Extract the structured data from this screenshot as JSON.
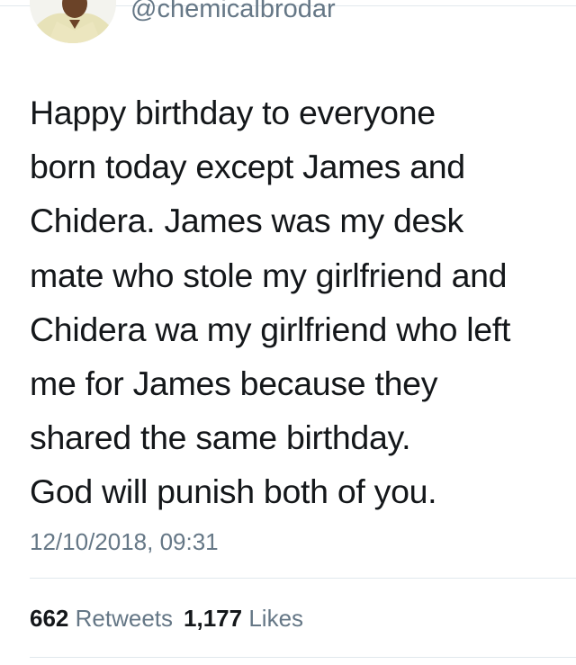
{
  "tweet": {
    "handle": "@chemicalbrodar",
    "text": "Happy birthday to everyone\nborn today except James and\nChidera. James was my desk\nmate who stole my girlfriend and\nChidera wa my girlfriend who left\nme for James because they\nshared the same birthday.\nGod will punish both of you.",
    "timestamp": "12/10/2018, 09:31"
  },
  "stats": {
    "retweets_count": "662",
    "retweets_label": "Retweets",
    "likes_count": "1,177",
    "likes_label": "Likes"
  },
  "colors": {
    "text": "#14171a",
    "secondary": "#657786",
    "divider": "#e1e8ed"
  }
}
